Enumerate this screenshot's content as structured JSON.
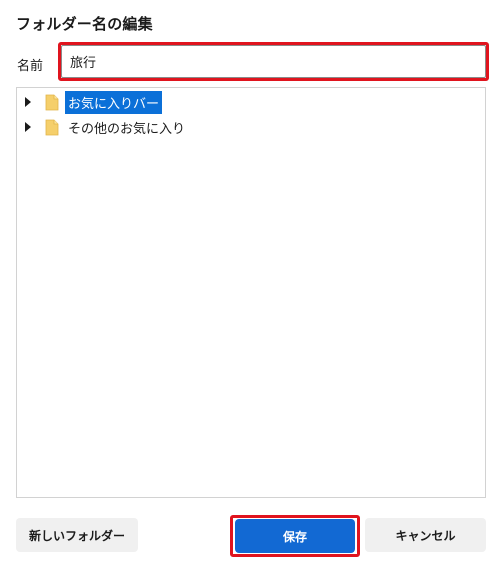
{
  "dialog": {
    "title": "フォルダー名の編集"
  },
  "name_field": {
    "label": "名前",
    "value": "旅行"
  },
  "tree": {
    "items": [
      {
        "label": "お気に入りバー",
        "icon": "folder-icon",
        "selected": true
      },
      {
        "label": "その他のお気に入り",
        "icon": "folder-icon",
        "selected": false
      }
    ]
  },
  "buttons": {
    "new_folder": "新しいフォルダー",
    "save": "保存",
    "cancel": "キャンセル"
  },
  "colors": {
    "accent": "#1269d3",
    "selection": "#0b70d8",
    "highlight": "#e0141e",
    "folder": "#f5cf6b"
  }
}
